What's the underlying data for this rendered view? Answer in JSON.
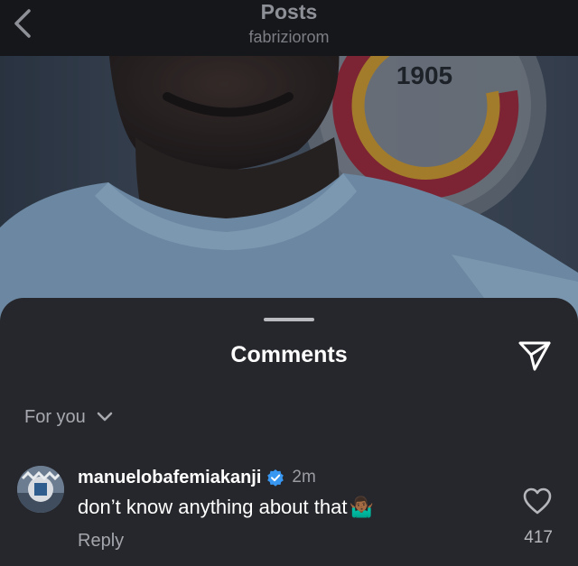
{
  "header": {
    "title": "Posts",
    "subtitle": "fabriziorom",
    "back_icon": "chevron-left-icon"
  },
  "post_image": {
    "logo_text": "1905"
  },
  "comments_sheet": {
    "title": "Comments",
    "share_icon": "paper-plane-icon",
    "filter": {
      "label": "For you",
      "icon": "chevron-down-icon"
    },
    "comments": [
      {
        "username": "manuelobafemiakanji",
        "verified": true,
        "timestamp": "2m",
        "text": "don’t know anything about that",
        "emoji": "🤷🏾‍♂️",
        "reply_label": "Reply",
        "like_count": "417",
        "like_icon": "heart-outline-icon"
      }
    ]
  },
  "colors": {
    "background": "#1f2024",
    "sheet": "#26272c",
    "verified_badge": "#3897f0",
    "jersey": "#8fb4d3",
    "logo_red": "#b52a3a",
    "logo_yellow": "#e7a92c"
  }
}
